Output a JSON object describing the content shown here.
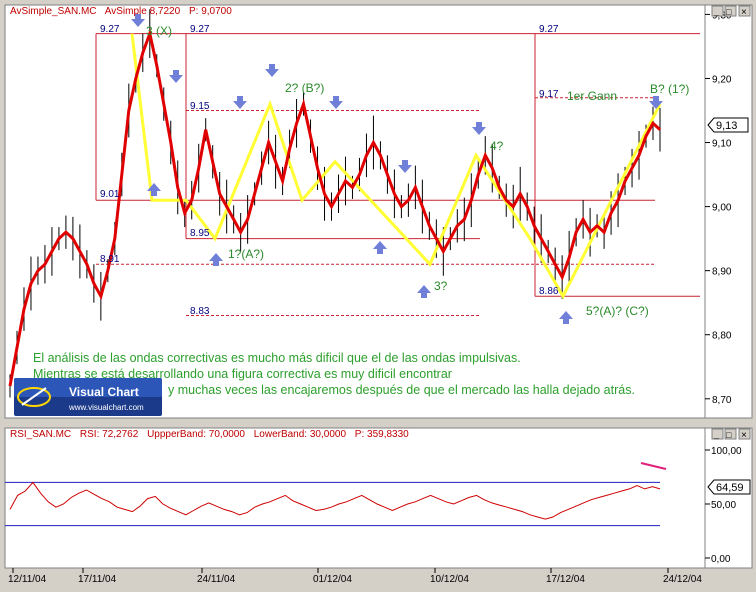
{
  "colors": {
    "price_line": "#e00000",
    "bar": "#000000",
    "wave": "#ffff33",
    "box": "#cc2233",
    "arrow": "#7080d8",
    "annotation": "#2b8a2b",
    "note_text": "#2ca02c",
    "band": "#2020c0",
    "rsi_line": "#d00000",
    "header": "#c00000"
  },
  "header": {
    "price": {
      "name": "AvSimple_SAN.MC",
      "ind": "AvSimple",
      "ind_val": "8,7220",
      "p_label": "P:",
      "p_val": "9,0700"
    },
    "rsi": {
      "name": "RSI_SAN.MC",
      "rsi_label": "RSI:",
      "rsi_val": "72,2762",
      "upper": "UppperBand: 70,0000",
      "lower": "LowerBand: 30,0000",
      "p_label": "P:",
      "p_val": "359,8330"
    }
  },
  "window_buttons": {
    "min": "_",
    "max": "□",
    "close": "×"
  },
  "annotations": {
    "w3x": "3 (X)",
    "w2b": "2? (B?)",
    "w1a": "1?(A?)",
    "w3": "3?",
    "w4": "4?",
    "w5": "5?(A)? (C?)",
    "gann": "1er Gann",
    "wb": "B? (1?)"
  },
  "level_labels": [
    "9.27",
    "9.27",
    "9.27",
    "9.15",
    "9.17",
    "9.01",
    "8.95",
    "8.91",
    "8.86",
    "8.83"
  ],
  "notes": {
    "line1": "El análisis de las ondas correctivas es mucho más dificil que el de las ondas impulsivas.",
    "line2": "Mientras se está desarrollando una figura correctiva es muy dificil encontrar",
    "line3": "y muchas veces las encajaremos después de que el mercado las halla dejado atrás."
  },
  "logo": {
    "title": "Visual Chart",
    "url": "www.visualchart.com"
  },
  "price_tag": "9,13",
  "rsi_tag": "64,59",
  "chart_data": [
    {
      "type": "line",
      "x": [
        "12/11/04",
        "17/11/04",
        "24/11/04",
        "01/12/04",
        "10/12/04",
        "17/12/04",
        "24/12/04"
      ],
      "y_ticks": [
        "9,30",
        "9,20",
        "9,10",
        "9,00",
        "8,90",
        "8,80",
        "8,70"
      ],
      "ylim": [
        8.67,
        9.31
      ],
      "series": [
        {
          "name": "AvSimple",
          "values": [
            8.72,
            8.78,
            8.84,
            8.88,
            8.9,
            8.91,
            8.93,
            8.95,
            8.96,
            8.95,
            8.93,
            8.91,
            8.88,
            8.86,
            8.9,
            8.95,
            9.05,
            9.15,
            9.2,
            9.24,
            9.27,
            9.22,
            9.16,
            9.1,
            9.03,
            8.99,
            9.01,
            9.06,
            9.12,
            9.07,
            9.02,
            9.0,
            8.98,
            8.96,
            8.98,
            9.02,
            9.06,
            9.1,
            9.07,
            9.04,
            9.09,
            9.13,
            9.16,
            9.11,
            9.06,
            9.02,
            9.0,
            9.02,
            9.04,
            9.03,
            9.05,
            9.08,
            9.1,
            9.08,
            9.05,
            9.02,
            9.0,
            9.01,
            9.03,
            9.0,
            8.97,
            8.95,
            8.93,
            8.95,
            8.97,
            8.98,
            9.01,
            9.05,
            9.08,
            9.06,
            9.03,
            9.01,
            9.0,
            9.02,
            9.0,
            8.97,
            8.95,
            8.93,
            8.91,
            8.89,
            8.92,
            8.96,
            8.98,
            8.96,
            8.97,
            8.96,
            8.99,
            9.01,
            9.04,
            9.06,
            9.08,
            9.11,
            9.13,
            9.12
          ]
        },
        {
          "name": "RSI",
          "values": [
            45,
            58,
            62,
            70,
            60,
            52,
            47,
            50,
            56,
            60,
            63,
            59,
            55,
            52,
            47,
            45,
            43,
            48,
            55,
            57,
            50,
            46,
            43,
            40,
            44,
            48,
            51,
            48,
            45,
            43,
            40,
            42,
            47,
            50,
            52,
            55,
            58,
            53,
            50,
            47,
            44,
            45,
            47,
            50,
            52,
            55,
            58,
            54,
            50,
            47,
            44,
            47,
            50,
            52,
            55,
            58,
            55,
            52,
            50,
            53,
            56,
            58,
            54,
            51,
            49,
            47,
            45,
            43,
            40,
            38,
            36,
            38,
            42,
            45,
            48,
            51,
            54,
            56,
            58,
            60,
            62,
            64,
            67,
            64,
            66,
            64
          ]
        }
      ],
      "bands": {
        "upper": 70,
        "lower": 30
      },
      "rsi_ticks": [
        "100,00",
        "50,00",
        "0,00"
      ],
      "rsi_ylim": [
        0,
        100
      ]
    }
  ]
}
